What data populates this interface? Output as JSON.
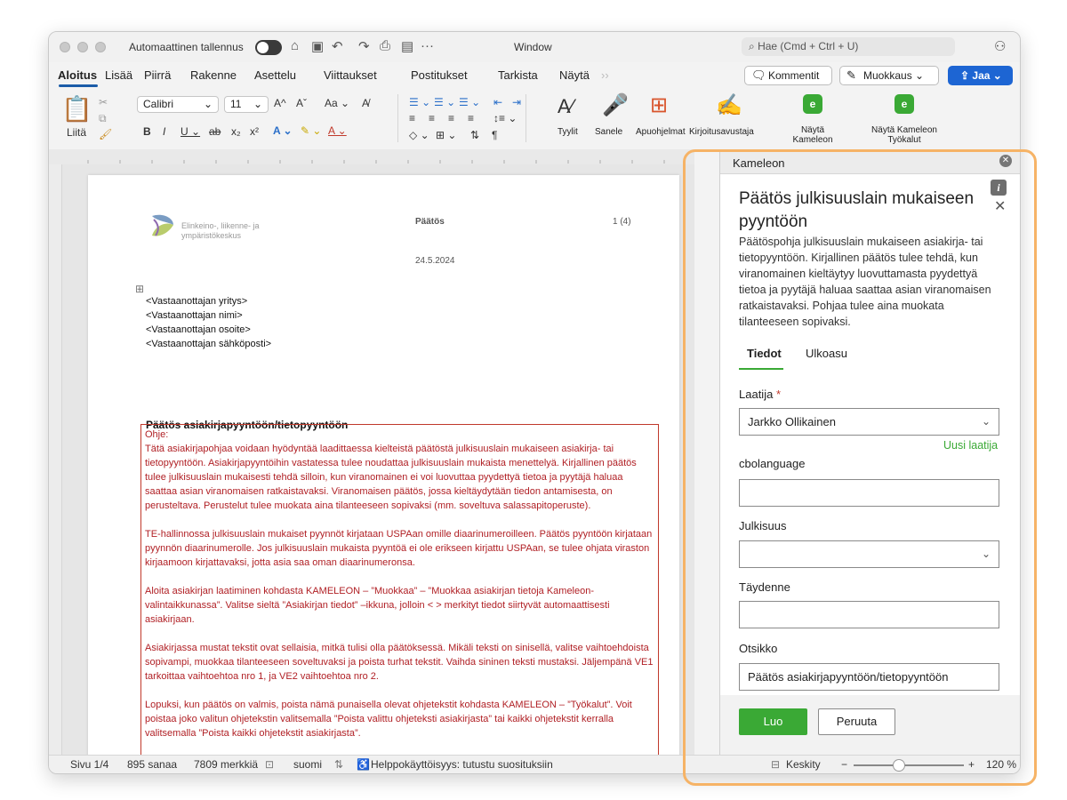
{
  "window": {
    "autosave_label": "Automaattinen tallennus",
    "title": "Window",
    "search_placeholder": "Hae (Cmd + Ctrl + U)"
  },
  "tabs": [
    "Aloitus",
    "Lisää",
    "Piirrä",
    "Rakenne",
    "Asettelu",
    "Viittaukset",
    "Postitukset",
    "Tarkista",
    "Näytä"
  ],
  "header_buttons": {
    "comments": "Kommentit",
    "editing": "Muokkaus",
    "share": "Jaa"
  },
  "ribbon": {
    "paste": "Liitä",
    "font": "Calibri",
    "size": "11",
    "styles": "Tyylit",
    "dictate": "Sanele",
    "addins": "Apuohjelmat",
    "writing_assistant": "Kirjoitusavustaja",
    "show_kameleon": "Näytä Kameleon",
    "show_kameleon_tools": "Näytä Kameleon Työkalut"
  },
  "document": {
    "logo_line1": "Elinkeino-, liikenne- ja",
    "logo_line2": "ympäristökeskus",
    "doc_type": "Päätös",
    "page_number": "1 (4)",
    "date": "24.5.2024",
    "recipient": [
      "<Vastaanottajan yritys>",
      "<Vastaanottajan nimi>",
      "<Vastaanottajan osoite>",
      "<Vastaanottajan sähköposti>"
    ],
    "heading": "Päätös asiakirjapyyntöön/tietopyyntöön",
    "ohje_title": "Ohje:",
    "ohje_p1": "Tätä asiakirjapohjaa voidaan hyödyntää laadittaessa kielteistä päätöstä julkisuuslain mukaiseen asiakirja- tai tietopyyntöön. Asiakirjapyyntöihin vastatessa tulee noudattaa julkisuuslain mukaista menettelyä. Kirjallinen päätös tulee julkisuuslain mukaisesti tehdä silloin, kun viranomainen ei voi luovuttaa pyydettyä tietoa ja pyytäjä haluaa saattaa asian viranomaisen ratkaistavaksi. Viranomaisen päätös, jossa kieltäydytään tiedon antamisesta, on perusteltava. Perustelut tulee muokata aina tilanteeseen sopivaksi (mm. soveltuva salassapitoperuste).",
    "ohje_p2": "TE-hallinnossa julkisuuslain mukaiset pyynnöt kirjataan USPAan omille diaarinumeroilleen. Päätös pyyntöön kirjataan pyynnön diaarinumerolle. Jos julkisuuslain mukaista pyyntöä ei ole erikseen kirjattu USPAan, se tulee ohjata viraston kirjaamoon kirjattavaksi, jotta asia saa oman diaarinumeronsa.",
    "ohje_p3": "Aloita asiakirjan laatiminen kohdasta KAMELEON – ”Muokkaa” – ”Muokkaa asiakirjan tietoja Kameleon-valintaikkunassa”. Valitse sieltä ”Asiakirjan tiedot” –ikkuna, jolloin < > merkityt tiedot siirtyvät automaattisesti asiakirjaan.",
    "ohje_p4": "Asiakirjassa mustat tekstit ovat sellaisia, mitkä tulisi olla päätöksessä. Mikäli teksti on sinisellä, valitse vaihtoehdoista sopivampi, muokkaa tilanteeseen soveltuvaksi ja poista turhat tekstit. Vaihda sininen teksti mustaksi. Jäljempänä VE1 tarkoittaa vaihtoehtoa nro 1, ja VE2 vaihtoehtoa nro 2.",
    "ohje_p5": "Lopuksi, kun päätös on valmis, poista nämä punaisella olevat ohjetekstit kohdasta KAMELEON – ”Työkalut”. Voit poistaa joko valitun ohjetekstin valitsemalla ”Poista valittu ohjeteksti asiakirjasta” tai kaikki ohjetekstit kerralla valitsemalla ”Poista kaikki ohjetekstit asiakirjasta”."
  },
  "panel": {
    "header": "Kameleon",
    "title": "Päätös julkisuuslain mukaiseen pyyntöön",
    "description": "Päätöspohja julkisuuslain mukaiseen asiakirja- tai tietopyyntöön. Kirjallinen päätös tulee tehdä, kun viranomainen kieltäytyy luovuttamasta pyydettyä tietoa ja pyytäjä haluaa saattaa asian viranomaisen ratkaistavaksi. Pohjaa tulee aina muokata tilanteeseen sopivaksi.",
    "tab_details": "Tiedot",
    "tab_layout": "Ulkoasu",
    "author_label": "Laatija",
    "author_value": "Jarkko Ollikainen",
    "new_author": "Uusi laatija",
    "cbolanguage_label": "cbolanguage",
    "cbolanguage_value": "",
    "publicity_label": "Julkisuus",
    "publicity_value": "",
    "supplement_label": "Täydenne",
    "supplement_value": "",
    "subject_label": "Otsikko",
    "subject_value": "Päätös asiakirjapyyntöön/tietopyyntöön",
    "create": "Luo",
    "cancel": "Peruuta"
  },
  "status": {
    "page": "Sivu 1/4",
    "words": "895 sanaa",
    "chars": "7809 merkkiä",
    "language": "suomi",
    "accessibility": "Helppokäyttöisyys: tutustu suosituksiin",
    "focus": "Keskity",
    "zoom": "120 %"
  },
  "colors": {
    "accent_blue": "#1d65d3",
    "kameleon_green": "#3aa935",
    "ohje_red": "#b01f24",
    "highlight_orange": "#f6b366"
  }
}
